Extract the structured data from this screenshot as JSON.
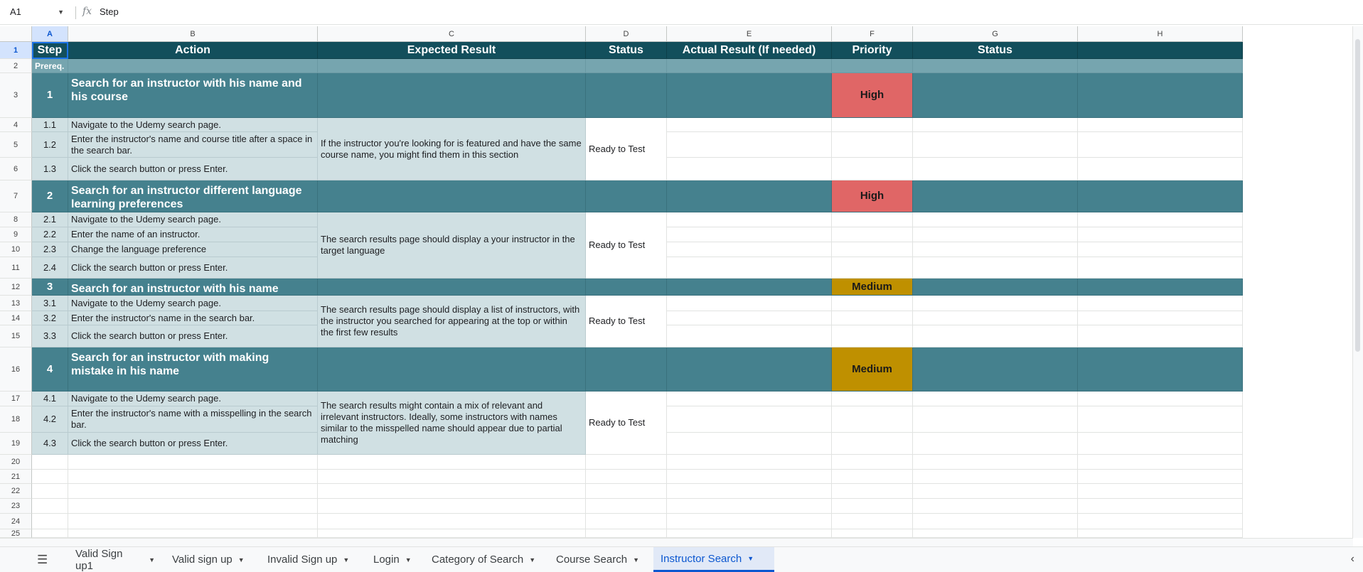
{
  "formula_bar": {
    "cell_ref": "A1",
    "fx": "fx",
    "value": "Step"
  },
  "columns": [
    "A",
    "B",
    "C",
    "D",
    "E",
    "F",
    "G",
    "H"
  ],
  "rows": [
    "1",
    "2",
    "3",
    "4",
    "5",
    "6",
    "7",
    "8",
    "9",
    "10",
    "11",
    "12",
    "13",
    "14",
    "15",
    "16",
    "17",
    "18",
    "19",
    "20",
    "21",
    "22",
    "23",
    "24",
    "25"
  ],
  "header": {
    "step": "Step",
    "action": "Action",
    "expected": "Expected Result",
    "status": "Status",
    "actual": "Actual Result (If needed)",
    "priority": "Priority",
    "status2": "Status"
  },
  "prereq": "Prereq.",
  "groups": [
    {
      "num": "1",
      "title": "Search for an instructor with his name and his course",
      "priority": "High",
      "steps": [
        {
          "num": "1.1",
          "action": "Navigate to the Udemy search page."
        },
        {
          "num": "1.2",
          "action": "Enter the instructor's name and course title after a space in the search bar."
        },
        {
          "num": "1.3",
          "action": "Click the search button or press Enter."
        }
      ],
      "expected": "If the instructor you're looking for is featured and have the same course name, you might find them in this section",
      "status": "Ready to Test"
    },
    {
      "num": "2",
      "title": "Search for an instructor different language learning preferences",
      "priority": "High",
      "steps": [
        {
          "num": "2.1",
          "action": "Navigate to the Udemy search page."
        },
        {
          "num": "2.2",
          "action": "Enter the name of an instructor."
        },
        {
          "num": "2.3",
          "action": "Change the language preference"
        },
        {
          "num": "2.4",
          "action": "Click the search button or press Enter."
        }
      ],
      "expected": "The search results page should display a your instructor in the target language",
      "status": "Ready to Test"
    },
    {
      "num": "3",
      "title": "Search for an instructor with his name",
      "priority": "Medium",
      "steps": [
        {
          "num": "3.1",
          "action": "Navigate to the Udemy search page."
        },
        {
          "num": "3.2",
          "action": "Enter the instructor's name in the search bar."
        },
        {
          "num": "3.3",
          "action": "Click the search button or press Enter."
        }
      ],
      "expected": "The search results page should display a list of instructors, with the instructor you searched for appearing at the top or within the first few results",
      "status": "Ready to Test"
    },
    {
      "num": "4",
      "title": "Search for an instructor with making mistake in his name",
      "priority": "Medium",
      "steps": [
        {
          "num": "4.1",
          "action": "Navigate to the Udemy search page."
        },
        {
          "num": "4.2",
          "action": "Enter the instructor's name with a misspelling in the search bar."
        },
        {
          "num": "4.3",
          "action": "Click the search button or press Enter."
        }
      ],
      "expected": "The search results might contain a mix of relevant and irrelevant instructors. Ideally, some instructors with names similar to the misspelled name should appear due to partial matching",
      "status": "Ready to Test"
    }
  ],
  "sheet_tabs": [
    "Valid Sign up1",
    "Valid sign up",
    "Invalid Sign up",
    "Login",
    "Category of Search",
    "Course Search",
    "Instructor Search"
  ],
  "active_tab": "Instructor Search",
  "colors": {
    "header": "#134f5c",
    "group": "#45818e",
    "sub": "#d0e0e3",
    "high": "#e06666",
    "medium": "#bf9000",
    "accent": "#0b57d0"
  }
}
